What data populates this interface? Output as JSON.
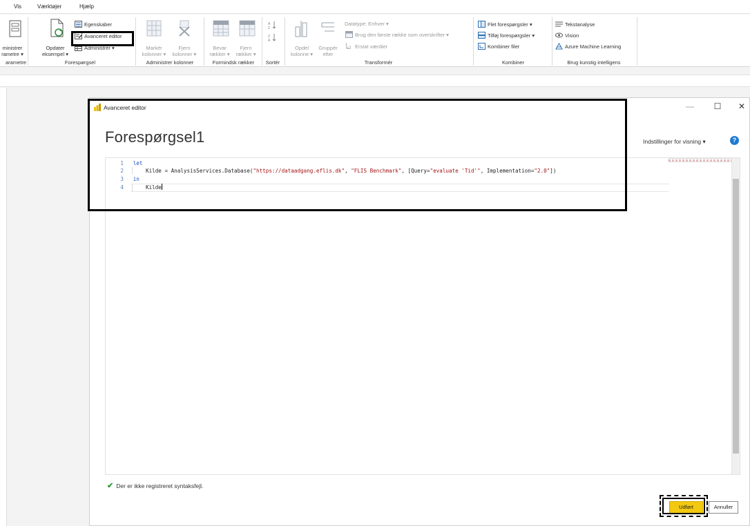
{
  "menu": {
    "items": [
      "Vis",
      "Værktøjer",
      "Hjælp"
    ]
  },
  "ribbon": {
    "partial_admin": [
      "ministrer",
      "rametre ▾"
    ],
    "update_preview": [
      "Opdater",
      "eksempel ▾"
    ],
    "properties": "Egenskaber",
    "advanced_editor": "Avanceret editor",
    "manage": "Administrer ▾",
    "choose_cols": [
      "Markér",
      "kolonner ▾"
    ],
    "remove_cols": [
      "Fjern",
      "kolonner ▾"
    ],
    "keep_rows": [
      "Bevar",
      "rækker ▾"
    ],
    "remove_rows": [
      "Fjern",
      "rækker ▾"
    ],
    "split_col": [
      "Opdel",
      "kolonne ▾"
    ],
    "group_by": [
      "Gruppér",
      "efter"
    ],
    "data_type": "Datatype: Enhver ▾",
    "first_row_headers": "Brug den første række som overskrifter ▾",
    "replace_values": "Erstat værdier",
    "merge_queries": "Flet forespørgsler ▾",
    "append_queries": "Tilføj forespørgsler ▾",
    "combine_files": "Kombiner filer",
    "text_analytics": "Tekstanalyse",
    "vision": "Vision",
    "azure_ml": "Azure Machine Learning",
    "groups": {
      "params": "arametre",
      "query": "Forespørgsel",
      "manage_cols": "Administrer kolonner",
      "reduce_rows": "Formindsk rækker",
      "sort": "Sortér",
      "transform": "Transformér",
      "combine": "Kombiner",
      "ai": "Brug kunstig intelligens"
    }
  },
  "dialog": {
    "window_title": "Avanceret editor",
    "heading": "Forespørgsel1",
    "view_settings": "Indstillinger for visning ▾",
    "help": "?",
    "minimize": "—",
    "maximize": "☐",
    "close": "✕",
    "code": {
      "line_numbers": [
        "1",
        "2",
        "3",
        "4"
      ],
      "l1_kw": "let",
      "l2_a": "Kilde = AnalysisServices.Database(",
      "l2_s1": "\"https://dataadgang.eflis.dk\"",
      "l2_b": ", ",
      "l2_s2": "\"FLIS Benchmark\"",
      "l2_c": ", [Query=",
      "l2_s3": "\"evaluate 'Tid'\"",
      "l2_d": ", Implementation=",
      "l2_s4": "\"2.0\"",
      "l2_e": "])",
      "l3_kw": "in",
      "l4": "Kilde"
    },
    "status": "Der er ikke registreret syntaksfejl.",
    "done": "Udført",
    "cancel": "Annuller"
  },
  "colors": {
    "accent": "#f2c811",
    "keyword": "#1f52c6",
    "string": "#a31515",
    "ok": "#2c9c3a",
    "help": "#1f7ad3"
  }
}
